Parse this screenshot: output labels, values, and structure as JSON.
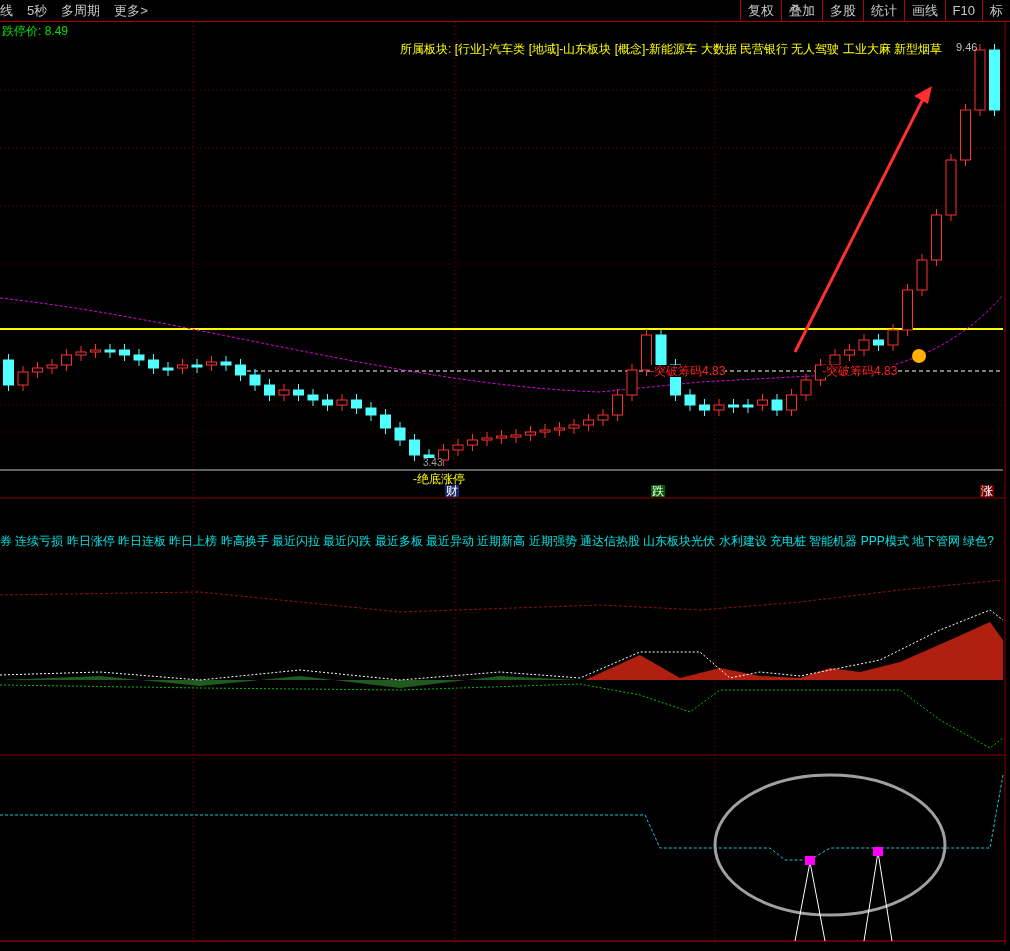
{
  "toolbar": {
    "left_items": [
      "线",
      "5秒",
      "多周期",
      "更多>"
    ],
    "right_buttons": [
      "复权",
      "叠加",
      "多股",
      "统计",
      "画线",
      "F10",
      "标"
    ]
  },
  "limit_down_price": "跌停价: 8.49",
  "sector_info": "所属板块: [行业]-汽车类 [地域]-山东板块 [概念]-新能源车 大数据 民营银行 无人驾驶 工业大麻 新型烟草",
  "high_price_label": "9.46",
  "chip_labels": [
    "-突破筹码4.83",
    "-突破筹码4.83"
  ],
  "low_price_label": "3.43",
  "bottom_label": "-绝底涨停",
  "event_markers": [
    {
      "text": "财",
      "kind": "news"
    },
    {
      "text": "跌",
      "kind": "fall"
    },
    {
      "text": "涨",
      "kind": "rise"
    }
  ],
  "concepts_text": "券 连续亏损 昨日涨停 昨日连板 昨日上榜 昨高换手 最近闪拉 最近闪跌 最近多板 最近异动 近期新高 近期强势 通达信热股 山东板块光伏 水利建设 充电桩 智能机器 PPP模式 地下管网 绿色?"
}
